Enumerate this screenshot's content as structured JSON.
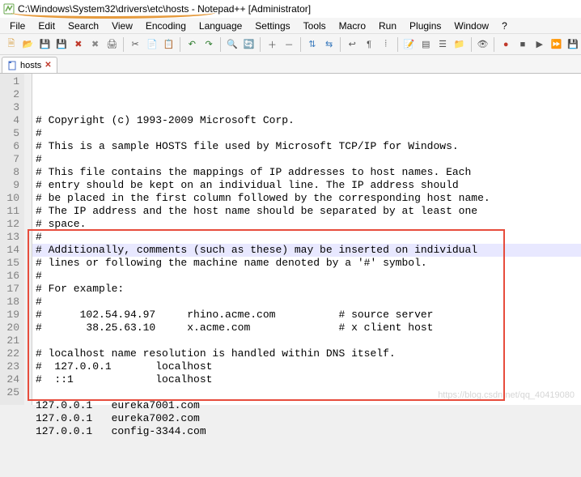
{
  "title": "C:\\Windows\\System32\\drivers\\etc\\hosts - Notepad++ [Administrator]",
  "menus": [
    "File",
    "Edit",
    "Search",
    "View",
    "Encoding",
    "Language",
    "Settings",
    "Tools",
    "Macro",
    "Run",
    "Plugins",
    "Window",
    "?"
  ],
  "toolbar_icons": [
    {
      "name": "new-file-icon",
      "glyph": "🗎",
      "color": "#d9a24a"
    },
    {
      "name": "open-file-icon",
      "glyph": "📂",
      "color": "#d9a24a"
    },
    {
      "name": "save-icon",
      "glyph": "💾",
      "color": "#4a72c8"
    },
    {
      "name": "save-all-icon",
      "glyph": "💾",
      "color": "#777"
    },
    {
      "name": "close-icon",
      "glyph": "✖",
      "color": "#c0392b"
    },
    {
      "name": "close-all-icon",
      "glyph": "✖",
      "color": "#888"
    },
    {
      "name": "print-icon",
      "glyph": "🖨",
      "color": "#555"
    },
    {
      "sep": true
    },
    {
      "name": "cut-icon",
      "glyph": "✂",
      "color": "#555"
    },
    {
      "name": "copy-icon",
      "glyph": "📄",
      "color": "#555"
    },
    {
      "name": "paste-icon",
      "glyph": "📋",
      "color": "#555"
    },
    {
      "sep": true
    },
    {
      "name": "undo-icon",
      "glyph": "↶",
      "color": "#2a7a2a"
    },
    {
      "name": "redo-icon",
      "glyph": "↷",
      "color": "#2a7a2a"
    },
    {
      "sep": true
    },
    {
      "name": "find-icon",
      "glyph": "🔍",
      "color": "#555"
    },
    {
      "name": "replace-icon",
      "glyph": "🔄",
      "color": "#555"
    },
    {
      "sep": true
    },
    {
      "name": "zoom-in-icon",
      "glyph": "＋",
      "color": "#555"
    },
    {
      "name": "zoom-out-icon",
      "glyph": "－",
      "color": "#555"
    },
    {
      "sep": true
    },
    {
      "name": "sync-v-icon",
      "glyph": "⇅",
      "color": "#3a7abd"
    },
    {
      "name": "sync-h-icon",
      "glyph": "⇆",
      "color": "#3a7abd"
    },
    {
      "sep": true
    },
    {
      "name": "wordwrap-icon",
      "glyph": "↩",
      "color": "#555"
    },
    {
      "name": "allchars-icon",
      "glyph": "¶",
      "color": "#555"
    },
    {
      "name": "indentguide-icon",
      "glyph": "⦙",
      "color": "#555"
    },
    {
      "sep": true
    },
    {
      "name": "lang-icon",
      "glyph": "📝",
      "color": "#7a4a9a"
    },
    {
      "name": "doc-map-icon",
      "glyph": "▤",
      "color": "#555"
    },
    {
      "name": "func-list-icon",
      "glyph": "☰",
      "color": "#555"
    },
    {
      "name": "folder-tree-icon",
      "glyph": "📁",
      "color": "#d9a24a"
    },
    {
      "sep": true
    },
    {
      "name": "monitor-icon",
      "glyph": "👁",
      "color": "#555"
    },
    {
      "sep": true
    },
    {
      "name": "record-macro-icon",
      "glyph": "●",
      "color": "#c0392b"
    },
    {
      "name": "stop-macro-icon",
      "glyph": "■",
      "color": "#555"
    },
    {
      "name": "play-macro-icon",
      "glyph": "▶",
      "color": "#555"
    },
    {
      "name": "play-multi-icon",
      "glyph": "⏩",
      "color": "#555"
    },
    {
      "name": "save-macro-icon",
      "glyph": "💾",
      "color": "#555"
    }
  ],
  "tab": {
    "label": "hosts"
  },
  "current_line_index": 13,
  "lines": [
    "# Copyright (c) 1993-2009 Microsoft Corp.",
    "#",
    "# This is a sample HOSTS file used by Microsoft TCP/IP for Windows.",
    "#",
    "# This file contains the mappings of IP addresses to host names. Each",
    "# entry should be kept on an individual line. The IP address should",
    "# be placed in the first column followed by the corresponding host name.",
    "# The IP address and the host name should be separated by at least one",
    "# space.",
    "#",
    "# Additionally, comments (such as these) may be inserted on individual",
    "# lines or following the machine name denoted by a '#' symbol.",
    "#",
    "# For example:",
    "#",
    "#      102.54.94.97     rhino.acme.com          # source server",
    "#       38.25.63.10     x.acme.com              # x client host",
    "",
    "# localhost name resolution is handled within DNS itself.",
    "#  127.0.0.1       localhost",
    "#  ::1             localhost",
    "",
    "127.0.0.1   eureka7001.com",
    "127.0.0.1   eureka7002.com",
    "127.0.0.1   config-3344.com"
  ],
  "red_box": {
    "top_line": 13,
    "bottom_line": 25
  },
  "watermark": "https://blog.csdn.net/qq_40419080"
}
